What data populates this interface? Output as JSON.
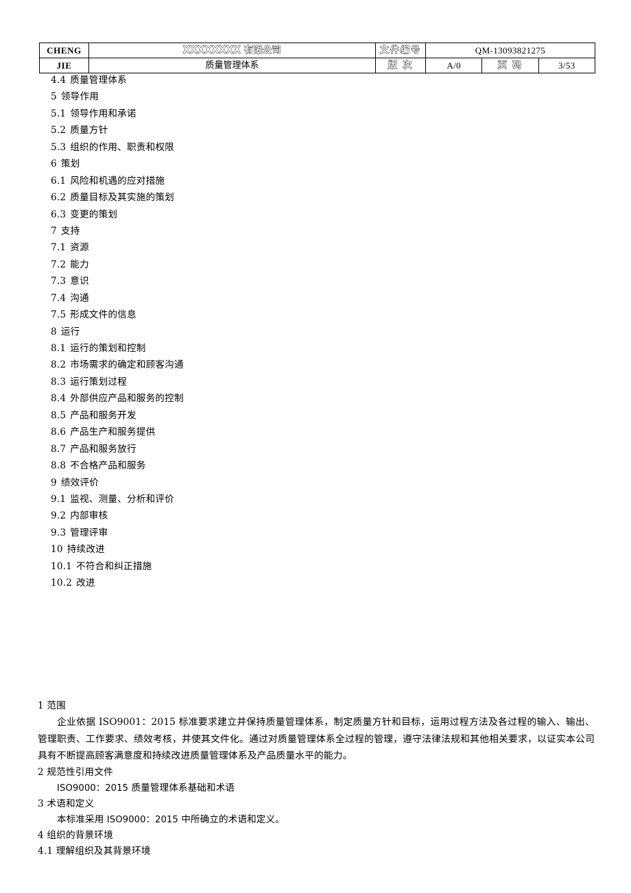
{
  "header": {
    "brand_line1": "CHENG",
    "brand_line2": "JIE",
    "company_name": "XXXXXXXX 有限公司",
    "document_title": "质量管理体系",
    "doc_number_label": "文件编号",
    "doc_number_value": "QM-13093821275",
    "version_label": "版 次",
    "version_value": "A/0",
    "page_label": "页 码",
    "page_value": "3/53"
  },
  "toc": {
    "items": [
      {
        "num": "4.4",
        "title": "质量管理体系"
      },
      {
        "num": "5",
        "title": "领导作用"
      },
      {
        "num": "5.1",
        "title": "领导作用和承诺"
      },
      {
        "num": "5.2",
        "title": "质量方针"
      },
      {
        "num": "5.3",
        "title": "组织的作用、职责和权限"
      },
      {
        "num": "6",
        "title": "策划"
      },
      {
        "num": "6.1",
        "title": "风险和机遇的应对措施"
      },
      {
        "num": "6.2",
        "title": "质量目标及其实施的策划"
      },
      {
        "num": "6.3",
        "title": "变更的策划"
      },
      {
        "num": "7",
        "title": "支持"
      },
      {
        "num": "7.1",
        "title": "资源"
      },
      {
        "num": "7.2",
        "title": "能力"
      },
      {
        "num": "7.3",
        "title": "意识"
      },
      {
        "num": "7.4",
        "title": "沟通"
      },
      {
        "num": "7.5",
        "title": "形成文件的信息"
      },
      {
        "num": "8",
        "title": "运行"
      },
      {
        "num": "8.1",
        "title": "运行的策划和控制"
      },
      {
        "num": "8.2",
        "title": "市场需求的确定和顾客沟通"
      },
      {
        "num": "8.3",
        "title": "运行策划过程"
      },
      {
        "num": "8.4",
        "title": "外部供应产品和服务的控制"
      },
      {
        "num": "8.5",
        "title": "产品和服务开发"
      },
      {
        "num": "8.6",
        "title": "产品生产和服务提供"
      },
      {
        "num": "8.7",
        "title": "产品和服务放行"
      },
      {
        "num": "8.8",
        "title": "不合格产品和服务"
      },
      {
        "num": "9",
        "title": "绩效评价"
      },
      {
        "num": "9.1",
        "title": "监视、测量、分析和评价"
      },
      {
        "num": "9.2",
        "title": "内部审核"
      },
      {
        "num": "9.3",
        "title": "管理评审"
      },
      {
        "num": "10",
        "title": "持续改进"
      },
      {
        "num": "10.1",
        "title": "不符合和纠正措施"
      },
      {
        "num": "10.2",
        "title": "改进"
      }
    ]
  },
  "body": {
    "section1_heading": "1 范围",
    "section1_paragraph": "企业依据 ISO9001：2015 标准要求建立并保持质量管理体系，制定质量方针和目标，运用过程方法及各过程的输入、输出、管理职责、工作要求、绩效考核，并使其文件化。通过对质量管理体系全过程的管理，遵守法律法规和其他相关要求，以证实本公司具有不断提高顾客满意度和持续改进质量管理体系及产品质量水平的能力。",
    "section2_heading": "2 规范性引用文件",
    "section2_ref_code": "ISO9000：2015",
    "section2_ref_title": "质量管理体系基础和术语",
    "section3_heading": "3 术语和定义",
    "section3_text_prefix": "本标准采用",
    "section3_ref_code": "ISO9000：2015",
    "section3_text_suffix": "中所确立的术语和定义。",
    "section4_heading": "4 组织的背景环境",
    "section4_1_heading": "4.1 理解组织及其背景环境"
  }
}
